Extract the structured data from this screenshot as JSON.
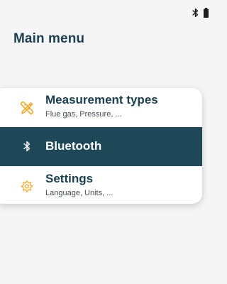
{
  "status_bar": {
    "icons": [
      "bluetooth-icon",
      "battery-icon"
    ]
  },
  "page": {
    "title": "Main menu"
  },
  "menu": {
    "items": [
      {
        "label": "Measurement types",
        "subtitle": "Flue gas, Pressure, ...",
        "icon": "measurement-tools-icon",
        "icon_color": "#f5a623",
        "selected": false
      },
      {
        "label": "Bluetooth",
        "subtitle": "",
        "icon": "bluetooth-icon",
        "icon_color": "#ffffff",
        "selected": true
      },
      {
        "label": "Settings",
        "subtitle": "Language, Units, ...",
        "icon": "gear-icon",
        "icon_color": "#f5a623",
        "selected": false
      }
    ]
  },
  "colors": {
    "primary": "#1c4050",
    "selected_bg": "#1e4757",
    "accent": "#f5a623",
    "background": "#f5f5f5"
  }
}
